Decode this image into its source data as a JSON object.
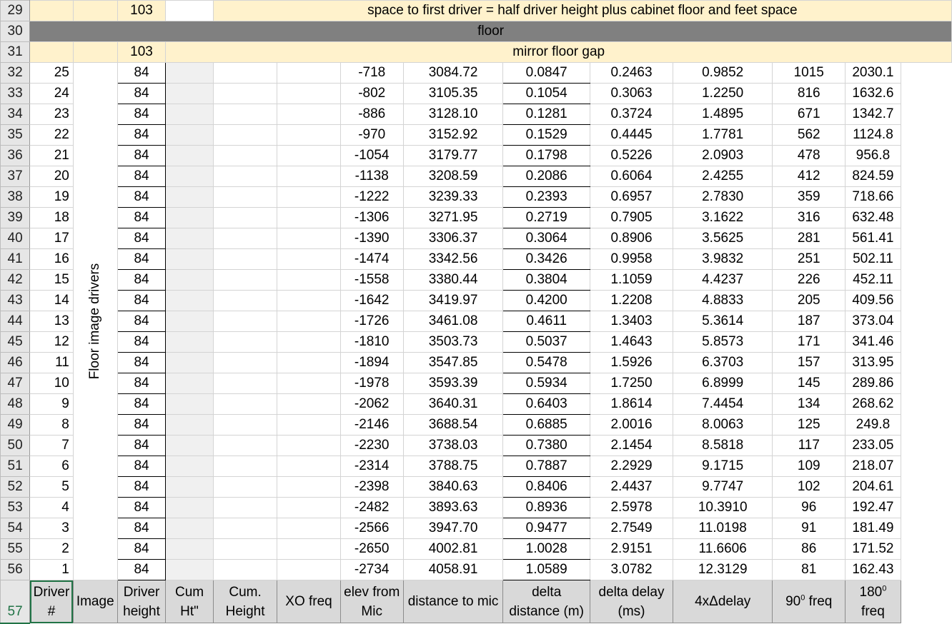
{
  "row29": {
    "row": "29",
    "height": "103",
    "note": "space to first driver = half driver height plus cabinet  floor and feet space"
  },
  "row30": {
    "row": "30",
    "label": "floor"
  },
  "row31": {
    "row": "31",
    "height": "103",
    "label": "mirror floor gap"
  },
  "vertical_label": "Floor image drivers",
  "rows": [
    {
      "row": "32",
      "driver": "25",
      "height": "84",
      "elev": "-718",
      "dist": "3084.72",
      "delta": "0.0847",
      "delay": "0.2463",
      "delay4": "0.9852",
      "f90": "1015",
      "f180": "2030.1"
    },
    {
      "row": "33",
      "driver": "24",
      "height": "84",
      "elev": "-802",
      "dist": "3105.35",
      "delta": "0.1054",
      "delay": "0.3063",
      "delay4": "1.2250",
      "f90": "816",
      "f180": "1632.6"
    },
    {
      "row": "34",
      "driver": "23",
      "height": "84",
      "elev": "-886",
      "dist": "3128.10",
      "delta": "0.1281",
      "delay": "0.3724",
      "delay4": "1.4895",
      "f90": "671",
      "f180": "1342.7"
    },
    {
      "row": "35",
      "driver": "22",
      "height": "84",
      "elev": "-970",
      "dist": "3152.92",
      "delta": "0.1529",
      "delay": "0.4445",
      "delay4": "1.7781",
      "f90": "562",
      "f180": "1124.8"
    },
    {
      "row": "36",
      "driver": "21",
      "height": "84",
      "elev": "-1054",
      "dist": "3179.77",
      "delta": "0.1798",
      "delay": "0.5226",
      "delay4": "2.0903",
      "f90": "478",
      "f180": "956.8"
    },
    {
      "row": "37",
      "driver": "20",
      "height": "84",
      "elev": "-1138",
      "dist": "3208.59",
      "delta": "0.2086",
      "delay": "0.6064",
      "delay4": "2.4255",
      "f90": "412",
      "f180": "824.59"
    },
    {
      "row": "38",
      "driver": "19",
      "height": "84",
      "elev": "-1222",
      "dist": "3239.33",
      "delta": "0.2393",
      "delay": "0.6957",
      "delay4": "2.7830",
      "f90": "359",
      "f180": "718.66"
    },
    {
      "row": "39",
      "driver": "18",
      "height": "84",
      "elev": "-1306",
      "dist": "3271.95",
      "delta": "0.2719",
      "delay": "0.7905",
      "delay4": "3.1622",
      "f90": "316",
      "f180": "632.48"
    },
    {
      "row": "40",
      "driver": "17",
      "height": "84",
      "elev": "-1390",
      "dist": "3306.37",
      "delta": "0.3064",
      "delay": "0.8906",
      "delay4": "3.5625",
      "f90": "281",
      "f180": "561.41"
    },
    {
      "row": "41",
      "driver": "16",
      "height": "84",
      "elev": "-1474",
      "dist": "3342.56",
      "delta": "0.3426",
      "delay": "0.9958",
      "delay4": "3.9832",
      "f90": "251",
      "f180": "502.11"
    },
    {
      "row": "42",
      "driver": "15",
      "height": "84",
      "elev": "-1558",
      "dist": "3380.44",
      "delta": "0.3804",
      "delay": "1.1059",
      "delay4": "4.4237",
      "f90": "226",
      "f180": "452.11"
    },
    {
      "row": "43",
      "driver": "14",
      "height": "84",
      "elev": "-1642",
      "dist": "3419.97",
      "delta": "0.4200",
      "delay": "1.2208",
      "delay4": "4.8833",
      "f90": "205",
      "f180": "409.56"
    },
    {
      "row": "44",
      "driver": "13",
      "height": "84",
      "elev": "-1726",
      "dist": "3461.08",
      "delta": "0.4611",
      "delay": "1.3403",
      "delay4": "5.3614",
      "f90": "187",
      "f180": "373.04"
    },
    {
      "row": "45",
      "driver": "12",
      "height": "84",
      "elev": "-1810",
      "dist": "3503.73",
      "delta": "0.5037",
      "delay": "1.4643",
      "delay4": "5.8573",
      "f90": "171",
      "f180": "341.46"
    },
    {
      "row": "46",
      "driver": "11",
      "height": "84",
      "elev": "-1894",
      "dist": "3547.85",
      "delta": "0.5478",
      "delay": "1.5926",
      "delay4": "6.3703",
      "f90": "157",
      "f180": "313.95"
    },
    {
      "row": "47",
      "driver": "10",
      "height": "84",
      "elev": "-1978",
      "dist": "3593.39",
      "delta": "0.5934",
      "delay": "1.7250",
      "delay4": "6.8999",
      "f90": "145",
      "f180": "289.86"
    },
    {
      "row": "48",
      "driver": "9",
      "height": "84",
      "elev": "-2062",
      "dist": "3640.31",
      "delta": "0.6403",
      "delay": "1.8614",
      "delay4": "7.4454",
      "f90": "134",
      "f180": "268.62"
    },
    {
      "row": "49",
      "driver": "8",
      "height": "84",
      "elev": "-2146",
      "dist": "3688.54",
      "delta": "0.6885",
      "delay": "2.0016",
      "delay4": "8.0063",
      "f90": "125",
      "f180": "249.8"
    },
    {
      "row": "50",
      "driver": "7",
      "height": "84",
      "elev": "-2230",
      "dist": "3738.03",
      "delta": "0.7380",
      "delay": "2.1454",
      "delay4": "8.5818",
      "f90": "117",
      "f180": "233.05"
    },
    {
      "row": "51",
      "driver": "6",
      "height": "84",
      "elev": "-2314",
      "dist": "3788.75",
      "delta": "0.7887",
      "delay": "2.2929",
      "delay4": "9.1715",
      "f90": "109",
      "f180": "218.07"
    },
    {
      "row": "52",
      "driver": "5",
      "height": "84",
      "elev": "-2398",
      "dist": "3840.63",
      "delta": "0.8406",
      "delay": "2.4437",
      "delay4": "9.7747",
      "f90": "102",
      "f180": "204.61"
    },
    {
      "row": "53",
      "driver": "4",
      "height": "84",
      "elev": "-2482",
      "dist": "3893.63",
      "delta": "0.8936",
      "delay": "2.5978",
      "delay4": "10.3910",
      "f90": "96",
      "f180": "192.47"
    },
    {
      "row": "54",
      "driver": "3",
      "height": "84",
      "elev": "-2566",
      "dist": "3947.70",
      "delta": "0.9477",
      "delay": "2.7549",
      "delay4": "11.0198",
      "f90": "91",
      "f180": "181.49"
    },
    {
      "row": "55",
      "driver": "2",
      "height": "84",
      "elev": "-2650",
      "dist": "4002.81",
      "delta": "1.0028",
      "delay": "2.9151",
      "delay4": "11.6606",
      "f90": "86",
      "f180": "171.52"
    },
    {
      "row": "56",
      "driver": "1",
      "height": "84",
      "elev": "-2734",
      "dist": "4058.91",
      "delta": "1.0589",
      "delay": "3.0782",
      "delay4": "12.3129",
      "f90": "81",
      "f180": "162.43"
    }
  ],
  "header": {
    "row": "57",
    "driver_a": "Driver",
    "driver_b": "#",
    "image": "Image",
    "height_a": "Driver",
    "height_b": "height",
    "cumht_a": "Cum",
    "cumht_b": "Ht\"",
    "cum_a": "Cum.",
    "cum_b": "Height",
    "xo": "XO freq",
    "elev_a": "elev from",
    "elev_b": "Mic",
    "dist": "distance to mic",
    "delta_a": "delta",
    "delta_b": "distance (m)",
    "delay_a": "delta delay",
    "delay_b": "(ms)",
    "delay4": "4xΔdelay",
    "f90_pre": "90",
    "f90_sup": "0",
    "f90_post": " freq",
    "f180_pre": "180",
    "f180_sup": "0",
    "f180_post": "freq"
  }
}
